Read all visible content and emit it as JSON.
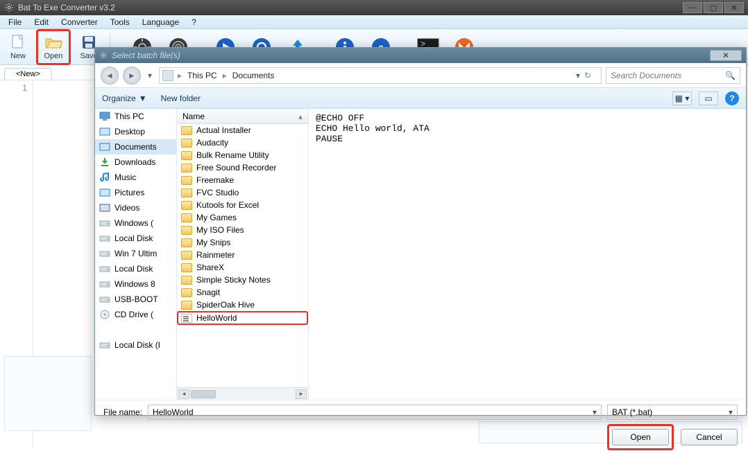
{
  "app": {
    "title": "Bat To Exe Converter v3.2"
  },
  "menu": {
    "file": "File",
    "edit": "Edit",
    "converter": "Converter",
    "tools": "Tools",
    "language": "Language",
    "help": "?"
  },
  "toolbar": {
    "new": "New",
    "open": "Open",
    "save": "Save"
  },
  "tab": {
    "label": "<New>"
  },
  "gutter": {
    "line1": "1"
  },
  "dialog": {
    "title": "Select batch file(s)",
    "breadcrumb": {
      "root": "This PC",
      "folder": "Documents"
    },
    "search_placeholder": "Search Documents",
    "organize": "Organize",
    "newfolder": "New folder",
    "col_name": "Name",
    "filename_label": "File name:",
    "filename_value": "HelloWorld",
    "filetype": "BAT (*.bat)",
    "open": "Open",
    "cancel": "Cancel",
    "preview": "@ECHO OFF\nECHO Hello world, ATA\nPAUSE"
  },
  "tree": [
    {
      "icon": "pc",
      "label": "This PC"
    },
    {
      "icon": "desktop",
      "label": "Desktop"
    },
    {
      "icon": "docs",
      "label": "Documents",
      "sel": true
    },
    {
      "icon": "download",
      "label": "Downloads"
    },
    {
      "icon": "music",
      "label": "Music"
    },
    {
      "icon": "pictures",
      "label": "Pictures"
    },
    {
      "icon": "videos",
      "label": "Videos"
    },
    {
      "icon": "drive",
      "label": "Windows ("
    },
    {
      "icon": "drive",
      "label": "Local Disk"
    },
    {
      "icon": "drive",
      "label": "Win 7 Ultim"
    },
    {
      "icon": "drive",
      "label": "Local Disk"
    },
    {
      "icon": "drive",
      "label": "Windows 8"
    },
    {
      "icon": "drive",
      "label": "USB-BOOT"
    },
    {
      "icon": "cd",
      "label": "CD Drive ("
    },
    {
      "icon": "spacer",
      "label": ""
    },
    {
      "icon": "drive",
      "label": "Local Disk (I"
    }
  ],
  "files": [
    {
      "t": "folder",
      "n": "Actual Installer"
    },
    {
      "t": "folder",
      "n": "Audacity"
    },
    {
      "t": "folder",
      "n": "Bulk Rename Utility"
    },
    {
      "t": "folder",
      "n": "Free Sound Recorder"
    },
    {
      "t": "folder",
      "n": "Freemake"
    },
    {
      "t": "folder",
      "n": "FVC Studio"
    },
    {
      "t": "folder",
      "n": "Kutools for Excel"
    },
    {
      "t": "folder",
      "n": "My Games"
    },
    {
      "t": "folder",
      "n": "My ISO Files"
    },
    {
      "t": "folder",
      "n": "My Snips"
    },
    {
      "t": "folder",
      "n": "Rainmeter"
    },
    {
      "t": "folder",
      "n": "ShareX"
    },
    {
      "t": "folder",
      "n": "Simple Sticky Notes"
    },
    {
      "t": "folder",
      "n": "Snagit"
    },
    {
      "t": "folder",
      "n": "SpiderOak Hive"
    },
    {
      "t": "bat",
      "n": "HelloWorld",
      "sel": true
    }
  ]
}
